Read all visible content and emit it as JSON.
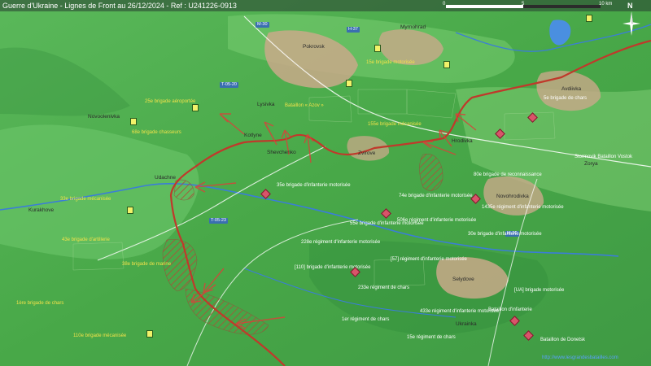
{
  "map": {
    "title": "Guerre d'Ukraine - Lignes de Front au 26/12/2024 - Ref : U241226-0913",
    "scale": {
      "start_label": "0",
      "mid_label": "5",
      "end_label": "10 km"
    },
    "compass": {
      "north_label": "N",
      "icon": "compass-rose-icon"
    },
    "colors": {
      "terrain_low": "#6cc46a",
      "terrain_high": "#3d8f3f",
      "river": "#3b7dd8",
      "russian_front": "#c0392b",
      "occupied_area": "#8b5a3c",
      "ukrainian_label": "#f2e24a",
      "russian_label": "#c86400"
    },
    "roads": [
      "M-30",
      "H-37",
      "T-05-20",
      "T-05-23",
      "M-30"
    ],
    "towns": [
      {
        "id": "pokrovsk",
        "name": "Pokrovsk"
      },
      {
        "id": "myrnohrad",
        "name": "Myrnohrad"
      },
      {
        "id": "selydove",
        "name": "Selydove"
      },
      {
        "id": "novohrodivka",
        "name": "Novohrodivka"
      },
      {
        "id": "avdiivka",
        "name": "Avdiivka"
      }
    ],
    "units": {
      "ua_north": "15e brigade motorisée",
      "ua_west_1": "25e brigade aéroportée",
      "ua_west_2": "68e brigade chasseurs",
      "ua_center_1": "Bataillon « Azov »",
      "ua_center_2": "155e brigade mécanisée",
      "ua_left_1": "33e brigade mécanisée",
      "ua_left_2": "43e brigade d'artillerie",
      "ua_left_3": "38e brigade de marine",
      "ua_sw_1": "1ère brigade de chars",
      "ua_sw_2": "110e brigade mécanisée",
      "ru_1": "35e brigade d'infanterie motorisée",
      "ru_2": "74e brigade d'infanterie motorisée",
      "ru_3": "1435e régiment d'infanterie motorisée",
      "ru_4": "506e régiment d'infanterie motorisée",
      "ru_5": "55e brigade d'infanterie motorisée",
      "ru_6": "30e brigade d'infanterie motorisée",
      "ru_7": "228e régiment d'infanterie motorisée",
      "ru_8": "[110] brigade d'infanterie motorisée",
      "ru_9": "233e régiment de chars",
      "ru_10": "1er régiment de chars",
      "ru_11": "433e régiment d'infanterie motorisée",
      "ru_12": "15e régiment de chars",
      "ru_13": "[57] régiment d'infanterie motorisée",
      "ru_14": "Bataillon d'infanterie",
      "ru_15": "[UA] brigade motorisée",
      "ru_16": "80e brigade de reconnaissance",
      "ru_17": "5e brigade de chars",
      "ru_18": "Stormovik Bataillon Vostok",
      "ru_19": "Bataillon de Donetsk"
    },
    "places": {
      "p1": "Zvirove",
      "p2": "Shevchenko",
      "p3": "Kotlyne",
      "p4": "Udachne",
      "p5": "Novoolenivka",
      "p6": "Kurakhove",
      "p7": "Zorya",
      "p8": "Hrodivka",
      "p9": "Lysivka",
      "p10": "Ukrainka"
    },
    "credit": "http://www.lesgrandesbatailles.com"
  }
}
